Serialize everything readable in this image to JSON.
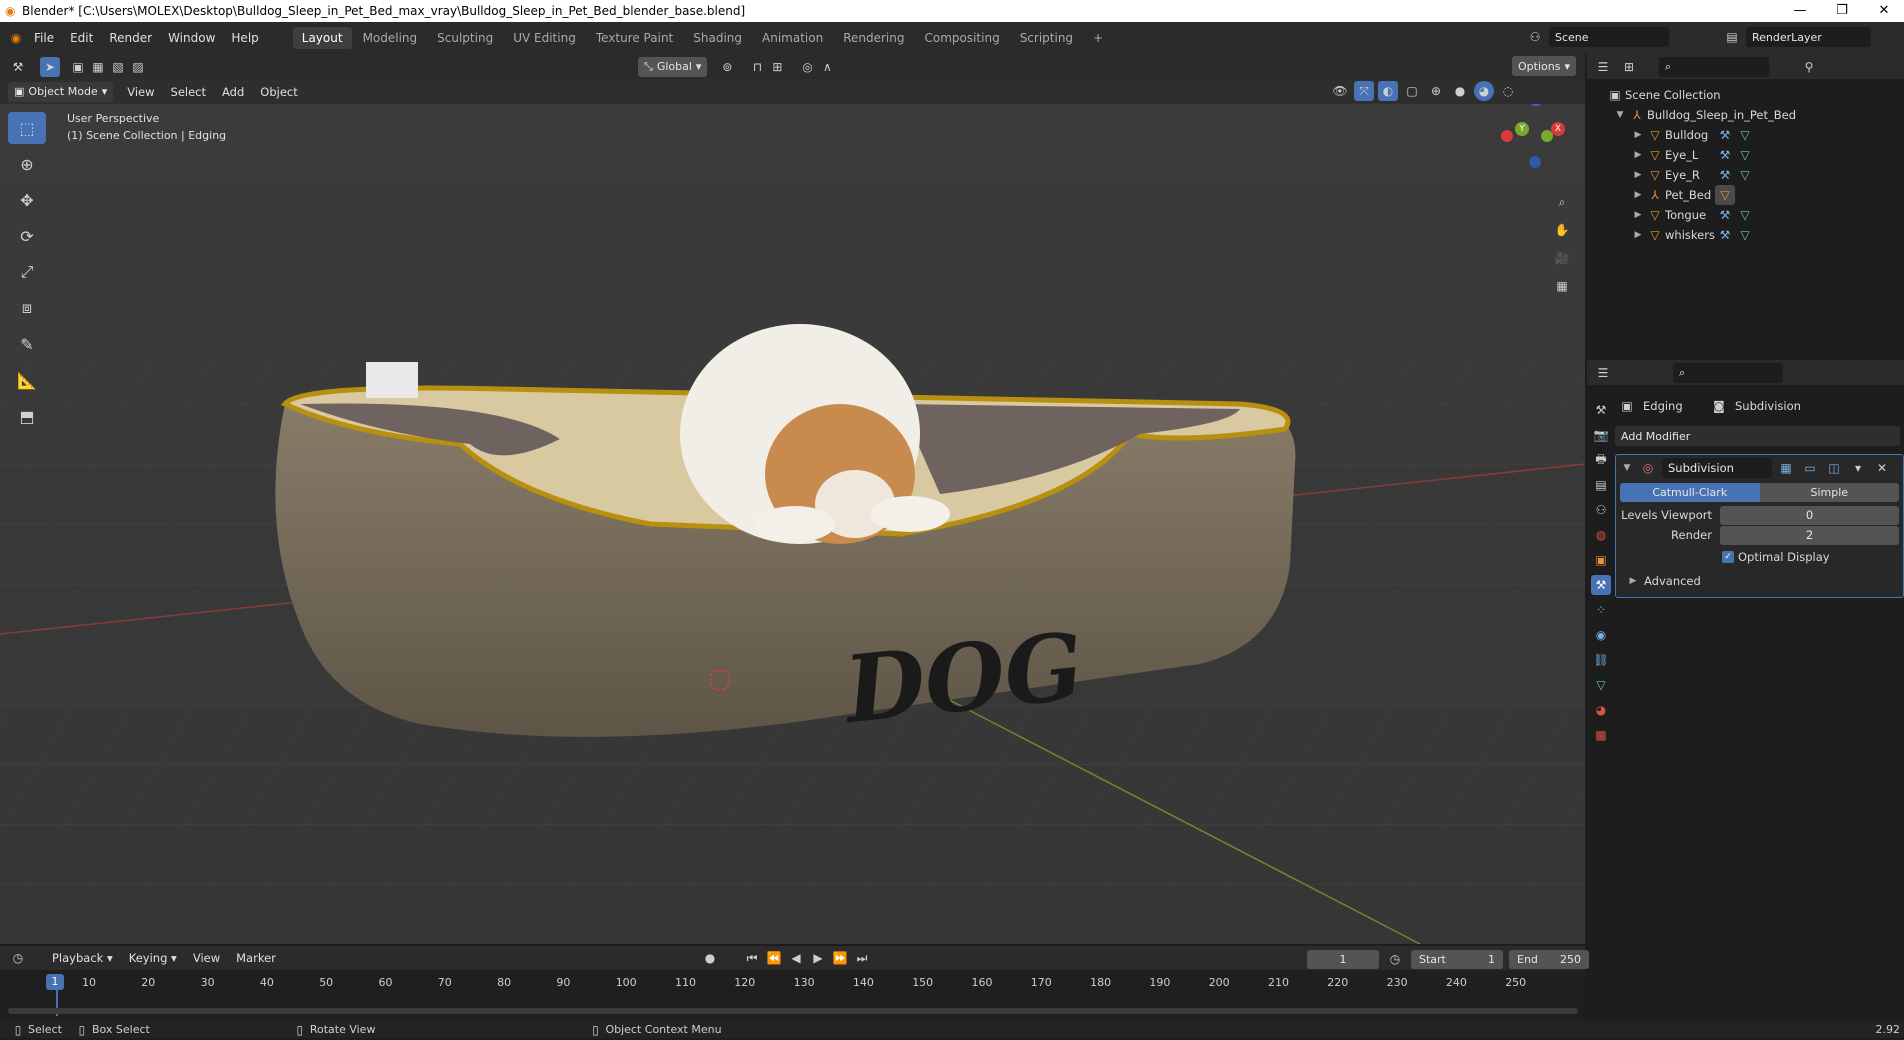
{
  "window": {
    "title": "Blender* [C:\\Users\\MOLEX\\Desktop\\Bulldog_Sleep_in_Pet_Bed_max_vray\\Bulldog_Sleep_in_Pet_Bed_blender_base.blend]"
  },
  "menus": [
    "File",
    "Edit",
    "Render",
    "Window",
    "Help"
  ],
  "workspaces": [
    "Layout",
    "Modeling",
    "Sculpting",
    "UV Editing",
    "Texture Paint",
    "Shading",
    "Animation",
    "Rendering",
    "Compositing",
    "Scripting"
  ],
  "active_workspace": "Layout",
  "scene": {
    "name": "Scene",
    "render_layer": "RenderLayer"
  },
  "viewport_header": {
    "mode": "Object Mode",
    "menus": [
      "View",
      "Select",
      "Add",
      "Object"
    ],
    "orientation": "Global",
    "options_label": "Options"
  },
  "viewport_overlay": {
    "line1": "User Perspective",
    "line2": "(1) Scene Collection | Edging",
    "bed_text": "DOG",
    "gizmo": {
      "x": "X",
      "y": "Y",
      "z": "Z"
    }
  },
  "outliner": {
    "root": "Scene Collection",
    "collection": "Bulldog_Sleep_in_Pet_Bed",
    "objects": [
      "Bulldog",
      "Eye_L",
      "Eye_R",
      "Pet_Bed",
      "Tongue",
      "whiskers"
    ]
  },
  "properties": {
    "object_name": "Edging",
    "modifier_tab": "Subdivision",
    "add_modifier": "Add Modifier",
    "modifier_name": "Subdivision",
    "catmull_clark": "Catmull-Clark",
    "simple": "Simple",
    "levels_viewport_label": "Levels Viewport",
    "levels_viewport_value": "0",
    "render_label": "Render",
    "render_value": "2",
    "optimal_display": "Optimal Display",
    "advanced": "Advanced"
  },
  "timeline": {
    "menus": [
      "Playback",
      "Keying",
      "View",
      "Marker"
    ],
    "current_frame": "1",
    "start_label": "Start",
    "start_value": "1",
    "end_label": "End",
    "end_value": "250",
    "ticks": [
      "10",
      "20",
      "30",
      "40",
      "50",
      "60",
      "70",
      "80",
      "90",
      "100",
      "110",
      "120",
      "130",
      "140",
      "150",
      "160",
      "170",
      "180",
      "190",
      "200",
      "210",
      "220",
      "230",
      "240",
      "250"
    ]
  },
  "statusbar": {
    "select": "Select",
    "box_select": "Box Select",
    "rotate_view": "Rotate View",
    "context_menu": "Object Context Menu",
    "version": "2.92"
  },
  "colors": {
    "accent": "#4772b3",
    "orange": "#e4923c",
    "teal": "#5ec9b3"
  }
}
